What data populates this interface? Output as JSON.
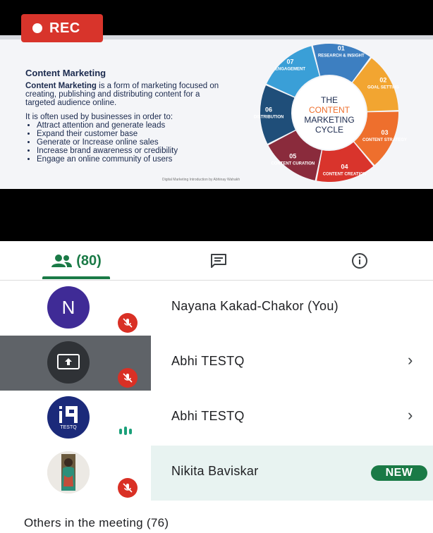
{
  "recording": {
    "label": "REC"
  },
  "slide": {
    "title": "Content Marketing",
    "intro_bold": "Content Marketing",
    "intro_rest": " is a form of marketing focused on creating, publishing and distributing content for a targeted audience online.",
    "used_by": "It is often used by businesses in order to:",
    "bullets": [
      "Attract attention and generate leads",
      "Expand their customer base",
      "Generate or Increase online sales",
      "Increase brand awareness or credibility",
      "Engage an online community of users"
    ],
    "footer": "Digital Marketing Introduction by Abhinay Wahakh",
    "cycle": {
      "center_lines": [
        "THE",
        "CONTENT",
        "MARKETING",
        "CYCLE"
      ],
      "segments": [
        {
          "num": "01",
          "title": "RESEARCH & INSIGHT",
          "color": "#3d7fc1"
        },
        {
          "num": "02",
          "title": "GOAL SETTING",
          "color": "#f2a531"
        },
        {
          "num": "03",
          "title": "CONTENT STRATEGY",
          "color": "#ee6f2d"
        },
        {
          "num": "04",
          "title": "CONTENT CREATION",
          "color": "#d9342c"
        },
        {
          "num": "05",
          "title": "CONTENT CURATION",
          "color": "#8a2b3c"
        },
        {
          "num": "06",
          "title": "DISTRIBUTION",
          "color": "#1f4e79"
        },
        {
          "num": "07",
          "title": "ENGAGEMENT",
          "color": "#3a9fd7"
        }
      ]
    }
  },
  "tabs": {
    "people_count": "(80)",
    "people_icon": "people-icon",
    "chat_icon": "chat-icon",
    "info_icon": "info-icon"
  },
  "participants": [
    {
      "name": "Nayana Kakad-Chakor (You)",
      "avatar_letter": "N",
      "avatar_color": "#3f2b96",
      "muted": true
    },
    {
      "name": "Abhi TESTQ",
      "avatar_type": "presenting",
      "muted": true,
      "highlight": "#5f6368"
    },
    {
      "name": "Abhi TESTQ",
      "avatar_type": "logo",
      "avatar_color": "#1b2a7a",
      "speaking": true,
      "logo_caption": "TESTQ"
    },
    {
      "name": "Nikita Baviskar",
      "avatar_type": "photo",
      "muted": true,
      "badge": "NEW",
      "highlight": "#e8f3f1"
    }
  ],
  "others": {
    "label": "Others in the meeting (76)"
  },
  "colors": {
    "accent_green": "#1a7a46",
    "mute_red": "#d93025",
    "rec_red": "#d8342b"
  }
}
